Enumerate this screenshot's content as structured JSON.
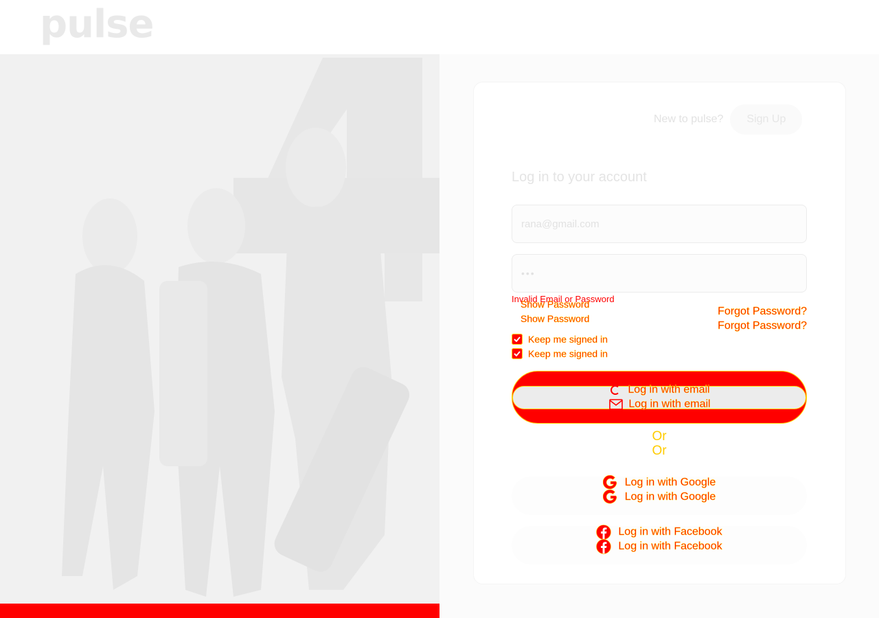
{
  "brand": {
    "logo_text": "pulse"
  },
  "signup": {
    "prompt": "New to pulse?",
    "button_label": "Sign Up"
  },
  "form": {
    "title": "Log in to your account",
    "email_value": "rana@gmail.com",
    "password_value": "•••",
    "error_message": "Invalid Email or Password",
    "show_password_label": "Show Password",
    "forgot_password_label": "Forgot Password?",
    "keep_signed_in_label": "Keep me signed in",
    "keep_signed_in_checked": true,
    "email_login_label": "Log in with email",
    "divider_text": "Or",
    "google_login_label": "Log in with Google",
    "facebook_login_label": "Log in with Facebook"
  },
  "colors": {
    "accent": "#ff0000",
    "outline": "#ffd600"
  }
}
